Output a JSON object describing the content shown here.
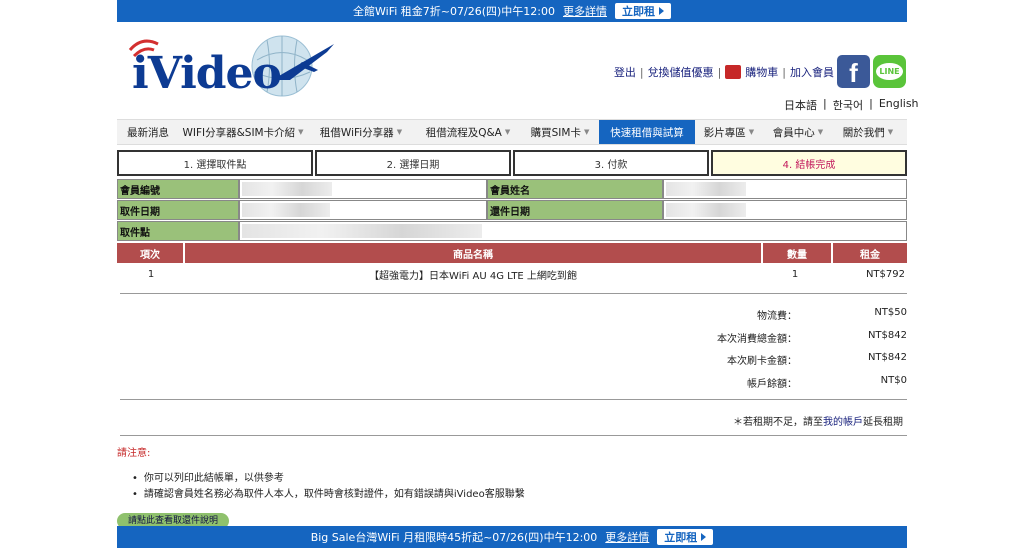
{
  "top_banner": {
    "text": "全館WiFi 租金7折~07/26(四)中午12:00",
    "more": "更多詳情",
    "rent": "立即租"
  },
  "logo": {
    "text": "iVideo"
  },
  "header_links": {
    "logout": "登出",
    "exchange": "兌換儲值優惠",
    "cart": "購物車",
    "join": "加入會員"
  },
  "social": {
    "facebook": "f",
    "line": "LINE"
  },
  "languages": [
    "日本語",
    "한국어",
    "English"
  ],
  "nav": [
    {
      "label": "最新消息",
      "caret": false,
      "active": false
    },
    {
      "label": "WIFI分享器&SIM卡介紹",
      "caret": true,
      "active": false
    },
    {
      "label": "租借WiFi分享器",
      "caret": true,
      "active": false
    },
    {
      "label": "租借流程及Q&A",
      "caret": true,
      "active": false
    },
    {
      "label": "購買SIM卡",
      "caret": true,
      "active": false
    },
    {
      "label": "快速租借與試算",
      "caret": false,
      "active": true
    },
    {
      "label": "影片專區",
      "caret": true,
      "active": false
    },
    {
      "label": "會員中心",
      "caret": true,
      "active": false
    },
    {
      "label": "關於我們",
      "caret": true,
      "active": false
    }
  ],
  "steps": [
    "1. 選擇取件點",
    "2. 選擇日期",
    "3. 付款",
    "4. 結帳完成"
  ],
  "info": {
    "member_id_label": "會員編號",
    "member_name_label": "會員姓名",
    "pickup_date_label": "取件日期",
    "return_date_label": "還件日期",
    "pickup_point_label": "取件點"
  },
  "items": {
    "headers": [
      "項次",
      "商品名稱",
      "數量",
      "租金"
    ],
    "rows": [
      {
        "no": "1",
        "name": "【超強電力】日本WiFi AU 4G LTE 上網吃到飽",
        "qty": "1",
        "price": "NT$792"
      }
    ]
  },
  "summary": [
    {
      "label": "物流費：",
      "value": "NT$50"
    },
    {
      "label": "本次消費總金額：",
      "value": "NT$842"
    },
    {
      "label": "本次刷卡金額：",
      "value": "NT$842"
    },
    {
      "label": "帳戶餘額：",
      "value": "NT$0"
    }
  ],
  "extend_note": {
    "prefix": "＊若租期不足，請至",
    "link": "我的帳戶",
    "suffix": "延長租期"
  },
  "notice": {
    "title": "請注意:",
    "items": [
      "你可以列印此結帳單，以供參考",
      "請確認會員姓名務必為取件人本人，取件時會核對證件，如有錯誤請與iVideo客服聯繫"
    ],
    "button": "請點此查看取還件說明"
  },
  "bottom_banner": {
    "text": "Big Sale台灣WiFi 月租限時45折起~07/26(四)中午12:00",
    "more": "更多詳情",
    "rent": "立即租"
  },
  "colors": {
    "brand_blue": "#1565c0",
    "label_green": "#9ac17a",
    "table_header": "#b24d4d",
    "current_step_text": "#c2185b"
  }
}
